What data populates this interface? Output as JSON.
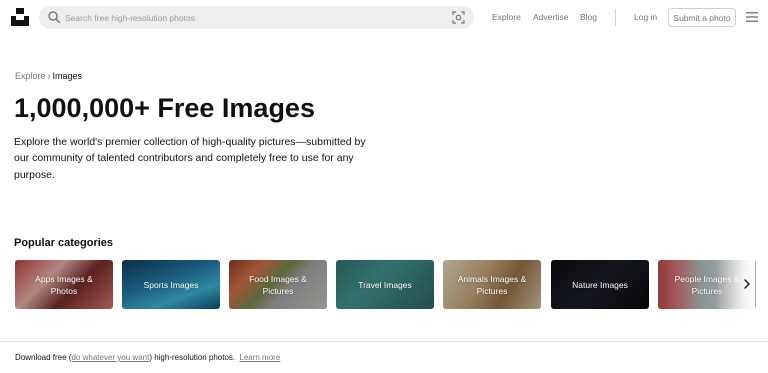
{
  "header": {
    "search_placeholder": "Search free high-resolution photos",
    "nav": {
      "explore": "Explore",
      "advertise": "Advertise",
      "blog": "Blog",
      "login": "Log in",
      "submit": "Submit a photo"
    },
    "icons": {
      "logo": "unsplash-logo-icon",
      "search": "search-icon",
      "visual_search": "visual-search-icon",
      "menu": "hamburger-menu-icon"
    }
  },
  "breadcrumb": {
    "parent": "Explore",
    "separator": "›",
    "current": "Images"
  },
  "hero": {
    "title": "1,000,000+ Free Images",
    "description": "Explore the world's premier collection of high-quality pictures—submitted by our community of talented contributors and completely free to use for any purpose."
  },
  "categories": {
    "title": "Popular categories",
    "items": [
      {
        "label": "Apps Images & Photos"
      },
      {
        "label": "Sports Images"
      },
      {
        "label": "Food Images & Pictures"
      },
      {
        "label": "Travel Images"
      },
      {
        "label": "Animals Images & Pictures"
      },
      {
        "label": "Nature Images"
      },
      {
        "label": "People Images & Pictures"
      }
    ],
    "next_icon": "chevron-right-icon"
  },
  "footer": {
    "prefix": "Download free (",
    "link": "do whatever you want",
    "suffix": ") high-resolution photos.",
    "learn_more": "Learn more"
  }
}
